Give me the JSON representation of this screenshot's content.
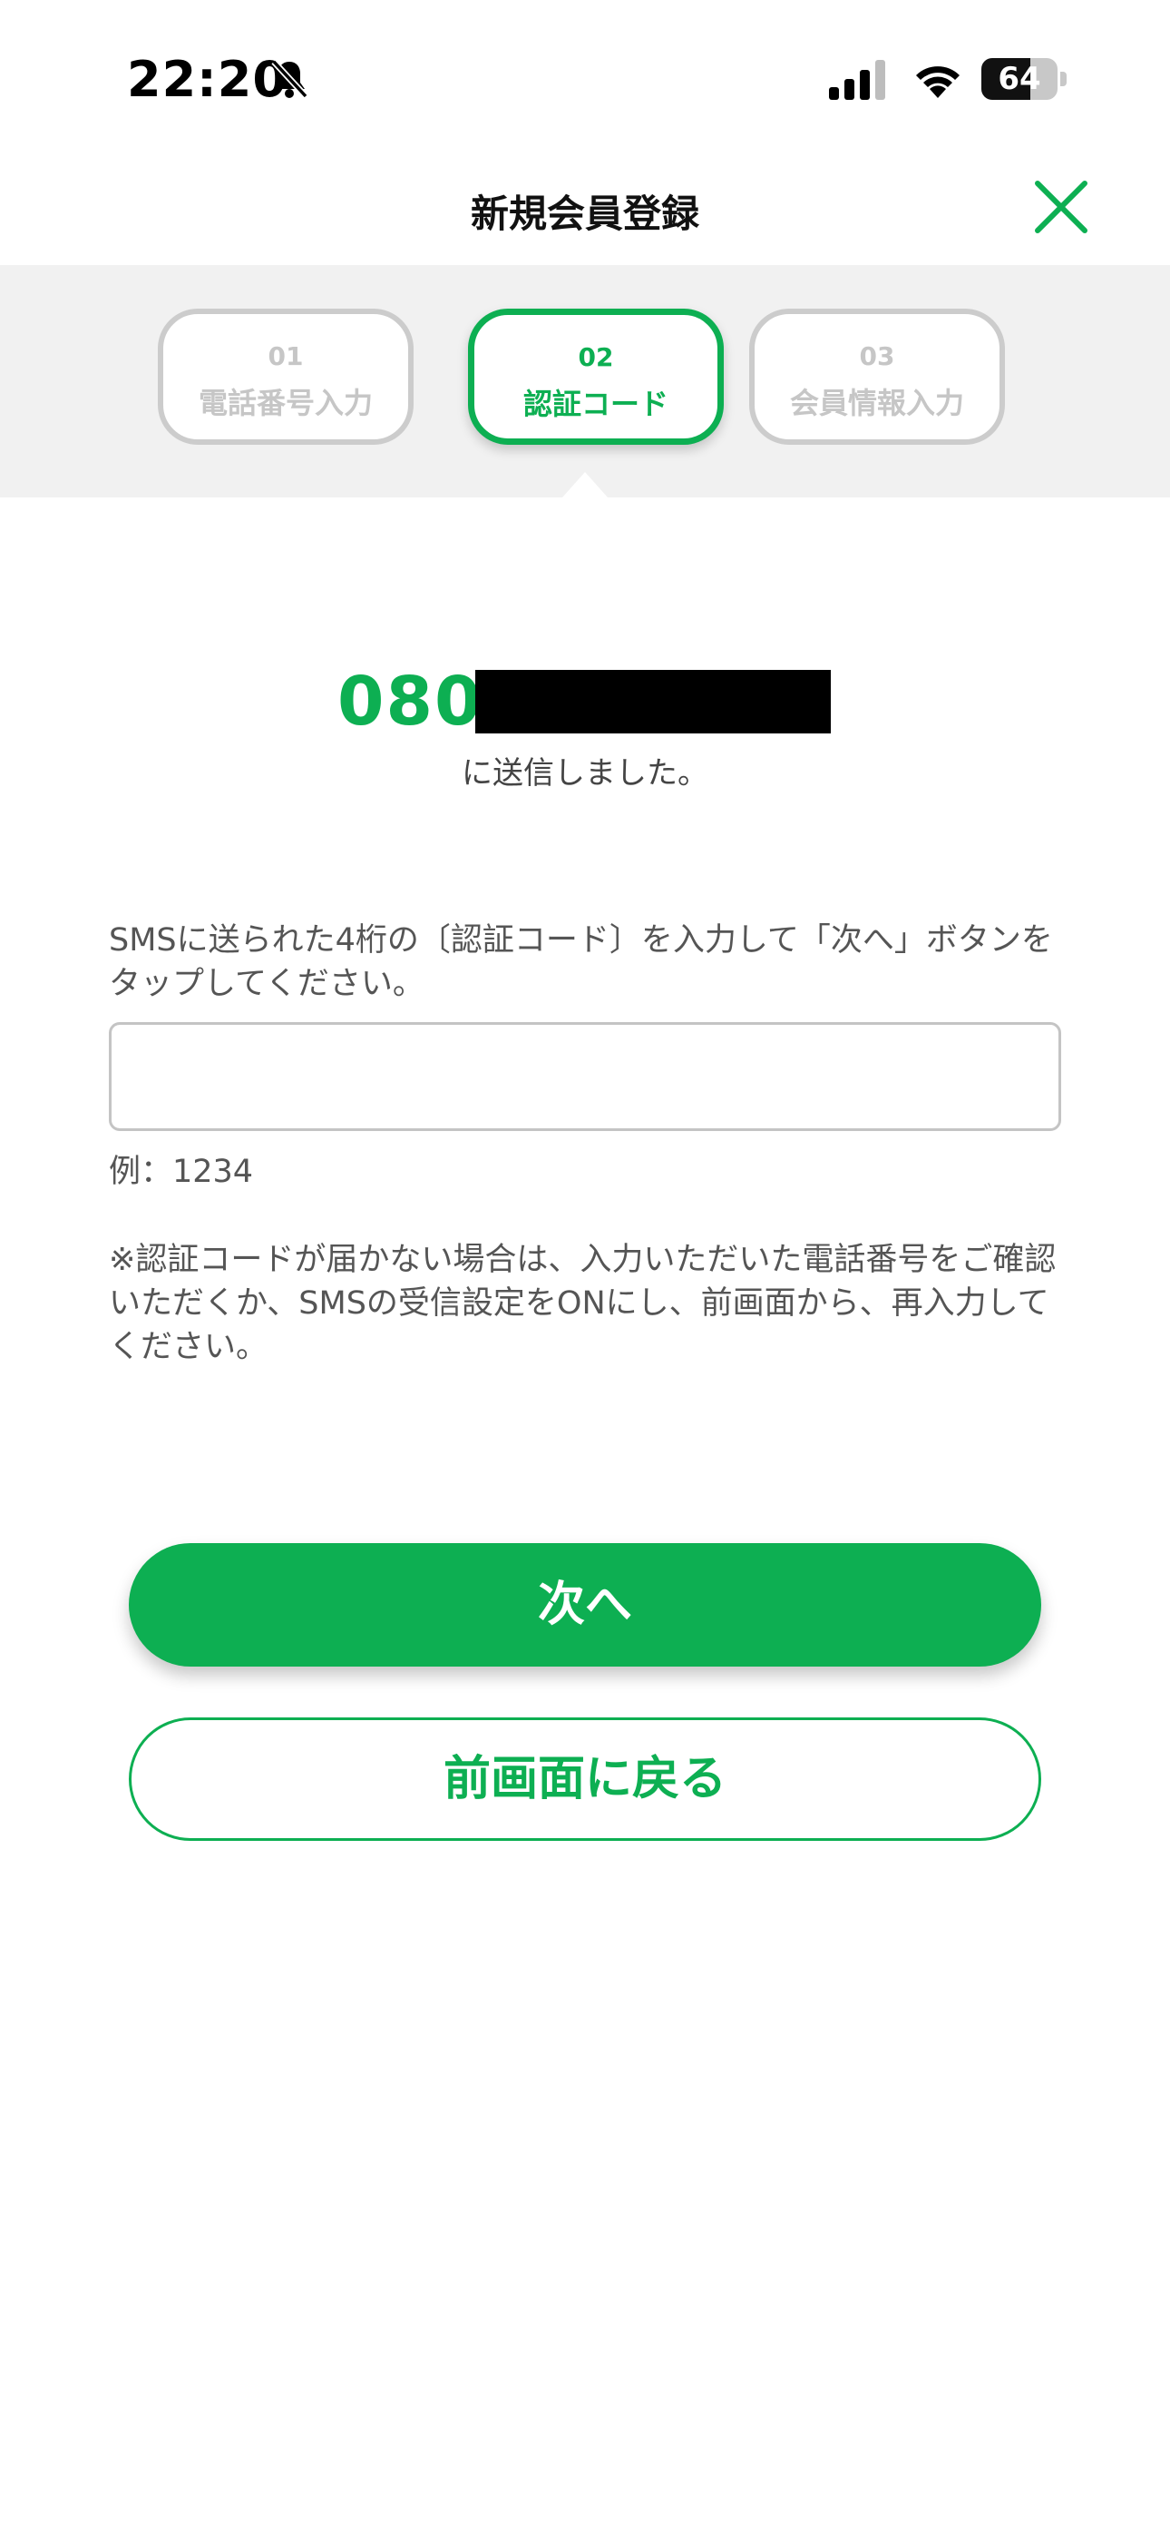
{
  "status_bar": {
    "time": "22:20",
    "battery_level": "64",
    "battery_fraction": 0.64,
    "icons": [
      "bell-off-icon",
      "cellular-signal-icon",
      "wifi-icon",
      "battery-icon"
    ]
  },
  "header": {
    "title": "新規会員登録",
    "close_icon": "close-icon",
    "accent_color": "#0daf52"
  },
  "stepper": {
    "steps": [
      {
        "number": "01",
        "label": "電話番号入力",
        "state": "inactive"
      },
      {
        "number": "02",
        "label": "認証コード",
        "state": "active"
      },
      {
        "number": "03",
        "label": "会員情報入力",
        "state": "inactive"
      }
    ]
  },
  "phone": {
    "prefix": "080",
    "sent_message": "に送信しました。"
  },
  "form": {
    "instruction": "SMSに送られた4桁の〔認証コード〕を入力して「次へ」ボタンをタップしてください。",
    "code_value": "",
    "example": "例：1234",
    "note": "※認証コードが届かない場合は、入力いただいた電話番号をご確認いただくか、SMSの受信設定をONにし、前画面から、再入力してください。"
  },
  "buttons": {
    "next_label": "次へ",
    "back_label": "前画面に戻る"
  }
}
